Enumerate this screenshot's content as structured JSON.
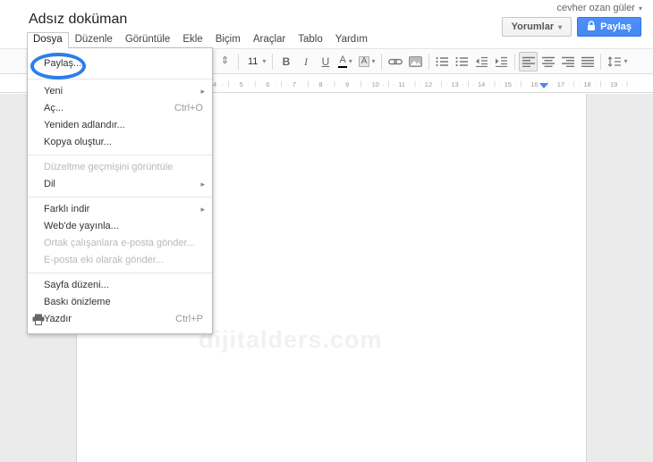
{
  "colors": {
    "share_button_blue": "#4d90fe",
    "annotation_ellipse_blue": "#2d7de9",
    "ruler_marker_blue": "#4a86e8",
    "doc_background_gray": "#ebebeb"
  },
  "header": {
    "account_name": "cevher ozan güler",
    "title": "Adsız doküman",
    "comments_label": "Yorumlar",
    "share_label": "Paylaş"
  },
  "menubar": {
    "items": [
      {
        "name": "dosya",
        "label": "Dosya",
        "active": true
      },
      {
        "name": "duzenle",
        "label": "Düzenle"
      },
      {
        "name": "goruntule",
        "label": "Görüntüle"
      },
      {
        "name": "ekle",
        "label": "Ekle"
      },
      {
        "name": "bicim",
        "label": "Biçim"
      },
      {
        "name": "araclar",
        "label": "Araçlar"
      },
      {
        "name": "tablo",
        "label": "Tablo"
      },
      {
        "name": "yardim",
        "label": "Yardım"
      }
    ]
  },
  "file_menu": {
    "items": [
      {
        "type": "item",
        "name": "paylas",
        "label": "Paylaş...",
        "first": true,
        "circled": true
      },
      {
        "type": "separator"
      },
      {
        "type": "item",
        "name": "yeni",
        "label": "Yeni",
        "submenu": true
      },
      {
        "type": "item",
        "name": "ac",
        "label": "Aç...",
        "shortcut": "Ctrl+O"
      },
      {
        "type": "item",
        "name": "yeniden-adlandir",
        "label": "Yeniden adlandır..."
      },
      {
        "type": "item",
        "name": "kopya-olustur",
        "label": "Kopya oluştur..."
      },
      {
        "type": "separator"
      },
      {
        "type": "item",
        "name": "duzeltme-gecmisi",
        "label": "Düzeltme geçmişini görüntüle",
        "disabled": true
      },
      {
        "type": "item",
        "name": "dil",
        "label": "Dil",
        "submenu": true
      },
      {
        "type": "separator"
      },
      {
        "type": "item",
        "name": "farkli-indir",
        "label": "Farklı indir",
        "submenu": true
      },
      {
        "type": "item",
        "name": "webde-yayinla",
        "label": "Web'de yayınla..."
      },
      {
        "type": "item",
        "name": "ortak-calisanlara-eposta",
        "label": "Ortak çalışanlara e-posta gönder...",
        "disabled": true
      },
      {
        "type": "item",
        "name": "eposta-eki-gonder",
        "label": "E-posta eki olarak gönder...",
        "disabled": true
      },
      {
        "type": "separator"
      },
      {
        "type": "item",
        "name": "sayfa-duzeni",
        "label": "Sayfa düzeni..."
      },
      {
        "type": "item",
        "name": "baski-onizleme",
        "label": "Baskı önizleme"
      },
      {
        "type": "item",
        "name": "yazdir",
        "label": "Yazdır",
        "icon": "printer",
        "shortcut": "Ctrl+P"
      }
    ]
  },
  "toolbar": {
    "font_size": "11",
    "items": [
      {
        "kind": "glyph",
        "name": "styles-stepper-icon",
        "glyph": "⇕",
        "cls": "st"
      },
      {
        "kind": "sep"
      },
      {
        "kind": "label-dd",
        "name": "font-size-select",
        "bindKey": "font_size"
      },
      {
        "kind": "sep"
      },
      {
        "kind": "glyph",
        "name": "bold-button",
        "glyph": "B",
        "cls": "b"
      },
      {
        "kind": "glyph",
        "name": "italic-button",
        "glyph": "I",
        "cls": "i"
      },
      {
        "kind": "glyph",
        "name": "underline-button",
        "glyph": "U",
        "cls": "u"
      },
      {
        "kind": "glyph-dd",
        "name": "text-color-button",
        "glyph": "A",
        "cls": "tc"
      },
      {
        "kind": "glyph-dd",
        "name": "highlight-color-button",
        "glyph": "A",
        "cls": "hc"
      },
      {
        "kind": "sep"
      },
      {
        "kind": "icon",
        "name": "insert-link-button",
        "icon": "link"
      },
      {
        "kind": "icon",
        "name": "insert-image-button",
        "icon": "image"
      },
      {
        "kind": "sep"
      },
      {
        "kind": "icon",
        "name": "numbered-list-button",
        "icon": "list"
      },
      {
        "kind": "icon",
        "name": "bulleted-list-button",
        "icon": "list"
      },
      {
        "kind": "icon",
        "name": "decrease-indent-button",
        "icon": "outdent"
      },
      {
        "kind": "icon",
        "name": "increase-indent-button",
        "icon": "indent"
      },
      {
        "kind": "sep"
      },
      {
        "kind": "icon",
        "name": "align-left-button",
        "icon": "align-left",
        "active": true
      },
      {
        "kind": "icon",
        "name": "align-center-button",
        "icon": "align-center"
      },
      {
        "kind": "icon",
        "name": "align-right-button",
        "icon": "align-right"
      },
      {
        "kind": "icon",
        "name": "justify-button",
        "icon": "justify"
      },
      {
        "kind": "sep"
      },
      {
        "kind": "icon-dd",
        "name": "line-spacing-button",
        "icon": "spacing"
      }
    ]
  },
  "ruler": {
    "start": 1,
    "end": 19,
    "marker_between": [
      16,
      17
    ]
  },
  "page": {
    "watermark": "dijitalders.com"
  }
}
